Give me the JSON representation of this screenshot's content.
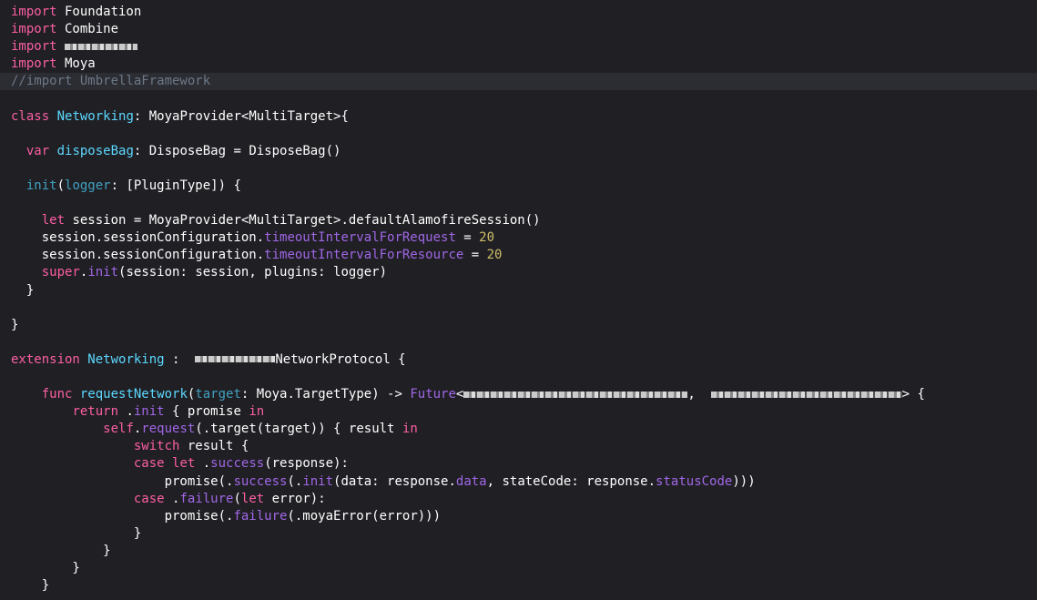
{
  "editor": {
    "lines": [
      [
        {
          "t": "import",
          "c": "kw"
        },
        {
          "t": " Foundation",
          "c": "plain"
        }
      ],
      [
        {
          "t": "import",
          "c": "kw"
        },
        {
          "t": " Combine",
          "c": "plain"
        }
      ],
      [
        {
          "t": "import",
          "c": "kw"
        },
        {
          "t": " ",
          "c": "plain"
        },
        {
          "redact": true,
          "w": 80
        }
      ],
      [
        {
          "t": "import",
          "c": "kw"
        },
        {
          "t": " Moya",
          "c": "plain"
        }
      ],
      [
        {
          "t": "//import UmbrellaFramework",
          "c": "comment"
        }
      ],
      [],
      [
        {
          "t": "class",
          "c": "kw"
        },
        {
          "t": " ",
          "c": "plain"
        },
        {
          "t": "Networking",
          "c": "type"
        },
        {
          "t": ": MoyaProvider<MultiTarget>{",
          "c": "plain"
        }
      ],
      [],
      [
        {
          "t": "  ",
          "c": "plain"
        },
        {
          "t": "var",
          "c": "kw"
        },
        {
          "t": " ",
          "c": "plain"
        },
        {
          "t": "disposeBag",
          "c": "type"
        },
        {
          "t": ": DisposeBag = DisposeBag()",
          "c": "plain"
        }
      ],
      [],
      [
        {
          "t": "  ",
          "c": "plain"
        },
        {
          "t": "init",
          "c": "attr"
        },
        {
          "t": "(",
          "c": "plain"
        },
        {
          "t": "logger",
          "c": "attr"
        },
        {
          "t": ": [PluginType]) {",
          "c": "plain"
        }
      ],
      [],
      [
        {
          "t": "    ",
          "c": "plain"
        },
        {
          "t": "let",
          "c": "kw"
        },
        {
          "t": " session = MoyaProvider<MultiTarget>.defaultAlamofireSession()",
          "c": "plain"
        }
      ],
      [
        {
          "t": "    session.sessionConfiguration.",
          "c": "plain"
        },
        {
          "t": "timeoutIntervalForRequest",
          "c": "member"
        },
        {
          "t": " = ",
          "c": "plain"
        },
        {
          "t": "20",
          "c": "num"
        }
      ],
      [
        {
          "t": "    session.sessionConfiguration.",
          "c": "plain"
        },
        {
          "t": "timeoutIntervalForResource",
          "c": "member"
        },
        {
          "t": " = ",
          "c": "plain"
        },
        {
          "t": "20",
          "c": "num"
        }
      ],
      [
        {
          "t": "    ",
          "c": "plain"
        },
        {
          "t": "super",
          "c": "kw"
        },
        {
          "t": ".",
          "c": "plain"
        },
        {
          "t": "init",
          "c": "member"
        },
        {
          "t": "(session: session, plugins: logger)",
          "c": "plain"
        }
      ],
      [
        {
          "t": "  }",
          "c": "plain"
        }
      ],
      [],
      [
        {
          "t": "}",
          "c": "plain"
        }
      ],
      [],
      [
        {
          "t": "extension",
          "c": "kw"
        },
        {
          "t": " ",
          "c": "plain"
        },
        {
          "t": "Networking",
          "c": "type"
        },
        {
          "t": " :  ",
          "c": "plain"
        },
        {
          "redact": true,
          "w": 88
        },
        {
          "t": "NetworkProtocol {",
          "c": "plain"
        }
      ],
      [],
      [
        {
          "t": "    ",
          "c": "plain"
        },
        {
          "t": "func",
          "c": "kw"
        },
        {
          "t": " ",
          "c": "plain"
        },
        {
          "t": "requestNetwork",
          "c": "type"
        },
        {
          "t": "(",
          "c": "plain"
        },
        {
          "t": "target",
          "c": "attr"
        },
        {
          "t": ": Moya.TargetType) -> ",
          "c": "plain"
        },
        {
          "t": "Future",
          "c": "member"
        },
        {
          "t": "<",
          "c": "plain"
        },
        {
          "redact": true,
          "w": 246
        },
        {
          "t": ",  ",
          "c": "plain"
        },
        {
          "redact": true,
          "w": 210
        },
        {
          "t": "> {",
          "c": "plain"
        }
      ],
      [
        {
          "t": "        ",
          "c": "plain"
        },
        {
          "t": "return",
          "c": "kw"
        },
        {
          "t": " .",
          "c": "plain"
        },
        {
          "t": "init",
          "c": "member"
        },
        {
          "t": " { promise ",
          "c": "plain"
        },
        {
          "t": "in",
          "c": "kw"
        }
      ],
      [
        {
          "t": "            ",
          "c": "plain"
        },
        {
          "t": "self",
          "c": "kw"
        },
        {
          "t": ".",
          "c": "plain"
        },
        {
          "t": "request",
          "c": "member"
        },
        {
          "t": "(.target(target)) { result ",
          "c": "plain"
        },
        {
          "t": "in",
          "c": "kw"
        }
      ],
      [
        {
          "t": "                ",
          "c": "plain"
        },
        {
          "t": "switch",
          "c": "kw"
        },
        {
          "t": " result {",
          "c": "plain"
        }
      ],
      [
        {
          "t": "                ",
          "c": "plain"
        },
        {
          "t": "case",
          "c": "kw"
        },
        {
          "t": " ",
          "c": "plain"
        },
        {
          "t": "let",
          "c": "kw"
        },
        {
          "t": " .",
          "c": "plain"
        },
        {
          "t": "success",
          "c": "member"
        },
        {
          "t": "(response):",
          "c": "plain"
        }
      ],
      [
        {
          "t": "                    promise(.",
          "c": "plain"
        },
        {
          "t": "success",
          "c": "member"
        },
        {
          "t": "(.",
          "c": "plain"
        },
        {
          "t": "init",
          "c": "member"
        },
        {
          "t": "(data: response.",
          "c": "plain"
        },
        {
          "t": "data",
          "c": "member"
        },
        {
          "t": ", stateCode: response.",
          "c": "plain"
        },
        {
          "t": "statusCode",
          "c": "member"
        },
        {
          "t": ")))",
          "c": "plain"
        }
      ],
      [
        {
          "t": "                ",
          "c": "plain"
        },
        {
          "t": "case",
          "c": "kw"
        },
        {
          "t": " .",
          "c": "plain"
        },
        {
          "t": "failure",
          "c": "member"
        },
        {
          "t": "(",
          "c": "plain"
        },
        {
          "t": "let",
          "c": "kw"
        },
        {
          "t": " error):",
          "c": "plain"
        }
      ],
      [
        {
          "t": "                    promise(.",
          "c": "plain"
        },
        {
          "t": "failure",
          "c": "member"
        },
        {
          "t": "(.moyaError(error)))",
          "c": "plain"
        }
      ],
      [
        {
          "t": "                }",
          "c": "plain"
        }
      ],
      [
        {
          "t": "            }",
          "c": "plain"
        }
      ],
      [
        {
          "t": "        }",
          "c": "plain"
        }
      ],
      [
        {
          "t": "    }",
          "c": "plain"
        }
      ]
    ],
    "current_line_index": 4,
    "colors": {
      "background": "#1f1f24",
      "current_line": "#2c2c33",
      "keyword": "#fc5fa3",
      "type_declaration": "#5dd8ff",
      "parameter": "#41a1c0",
      "member": "#a167e6",
      "number": "#d0bf69",
      "comment": "#6c7986",
      "plain": "#ffffff"
    }
  }
}
